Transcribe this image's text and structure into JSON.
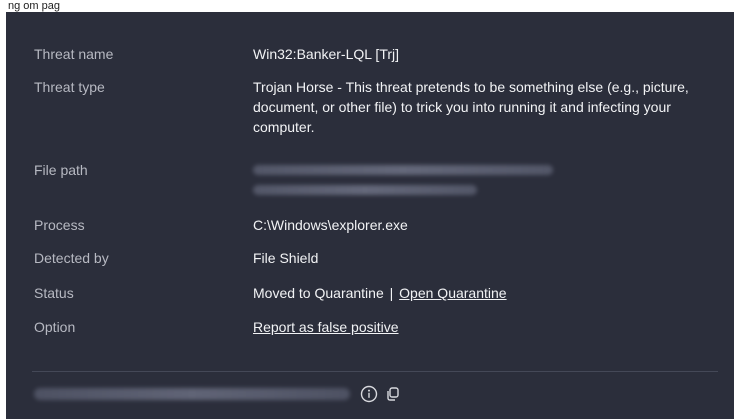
{
  "caption": "ng    om   pag",
  "details": {
    "threat_name": {
      "label": "Threat name",
      "value": "Win32:Banker-LQL [Trj]"
    },
    "threat_type": {
      "label": "Threat type",
      "value": "Trojan Horse - This threat pretends to be something else (e.g., picture, document, or other file) to trick you into running it and infecting your computer."
    },
    "file_path": {
      "label": "File path"
    },
    "process": {
      "label": "Process",
      "value": "C:\\Windows\\explorer.exe"
    },
    "detected_by": {
      "label": "Detected by",
      "value": "File Shield"
    },
    "status": {
      "label": "Status",
      "value": "Moved to Quarantine",
      "separator": "|",
      "link": "Open Quarantine"
    },
    "option": {
      "label": "Option",
      "link": "Report as false positive"
    }
  },
  "footer": {
    "info_icon": "info-icon",
    "copy_icon": "copy-icon"
  },
  "colors": {
    "panel_bg": "#2b2e3b",
    "label": "#b7b9c2",
    "value": "#f2f3f5"
  }
}
